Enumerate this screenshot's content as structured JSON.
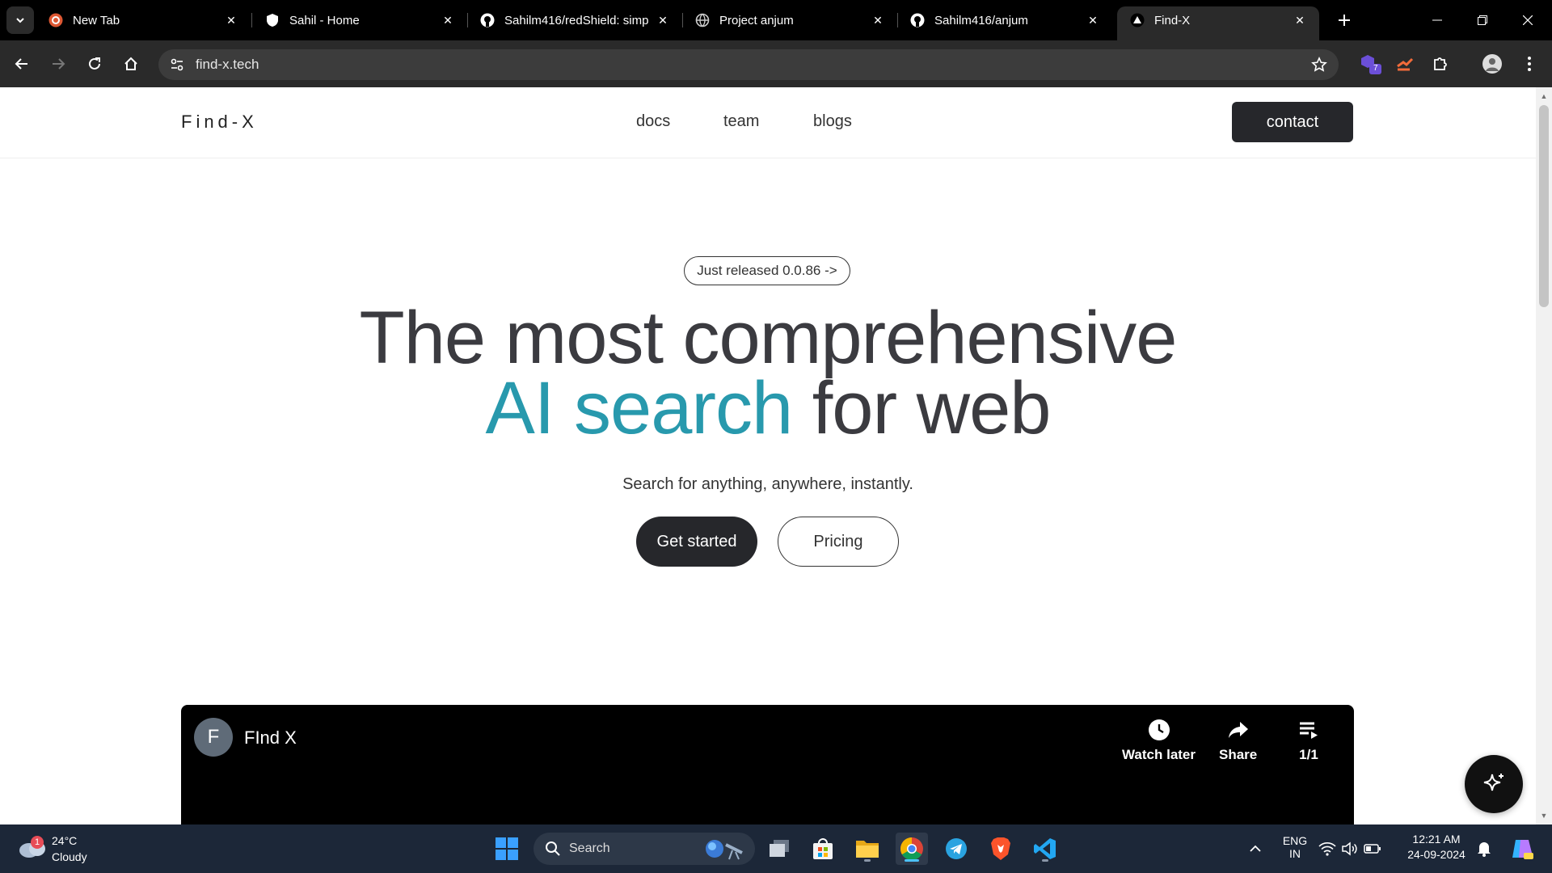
{
  "browser": {
    "tabs": [
      {
        "title": "New Tab",
        "icon": "duckduckgo-icon"
      },
      {
        "title": "Sahil - Home",
        "icon": "shield-icon"
      },
      {
        "title": "Sahilm416/redShield: simp",
        "icon": "github-icon"
      },
      {
        "title": "Project anjum",
        "icon": "globe-icon"
      },
      {
        "title": "Sahilm416/anjum",
        "icon": "github-icon"
      },
      {
        "title": "Find-X",
        "icon": "triangle-icon",
        "active": true
      }
    ],
    "url": "find-x.tech",
    "extension_badge": "7"
  },
  "site": {
    "logo": "Find-X",
    "nav": [
      "docs",
      "team",
      "blogs"
    ],
    "contact_label": "contact",
    "release_pill": "Just released 0.0.86 ->",
    "hero_line1": "The most comprehensive",
    "hero_accent": "AI search",
    "hero_rest": " for web",
    "subtitle": "Search for anything, anywhere, instantly.",
    "cta_primary": "Get started",
    "cta_secondary": "Pricing",
    "accent_color": "#2899ad"
  },
  "video": {
    "channel_initial": "F",
    "title": "FInd X",
    "watch_later": "Watch later",
    "share": "Share",
    "playlist_count": "1/1"
  },
  "taskbar": {
    "weather_badge": "1",
    "temperature": "24°C",
    "condition": "Cloudy",
    "search_label": "Search",
    "lang_line1": "ENG",
    "lang_line2": "IN",
    "time": "12:21 AM",
    "date": "24-09-2024"
  }
}
